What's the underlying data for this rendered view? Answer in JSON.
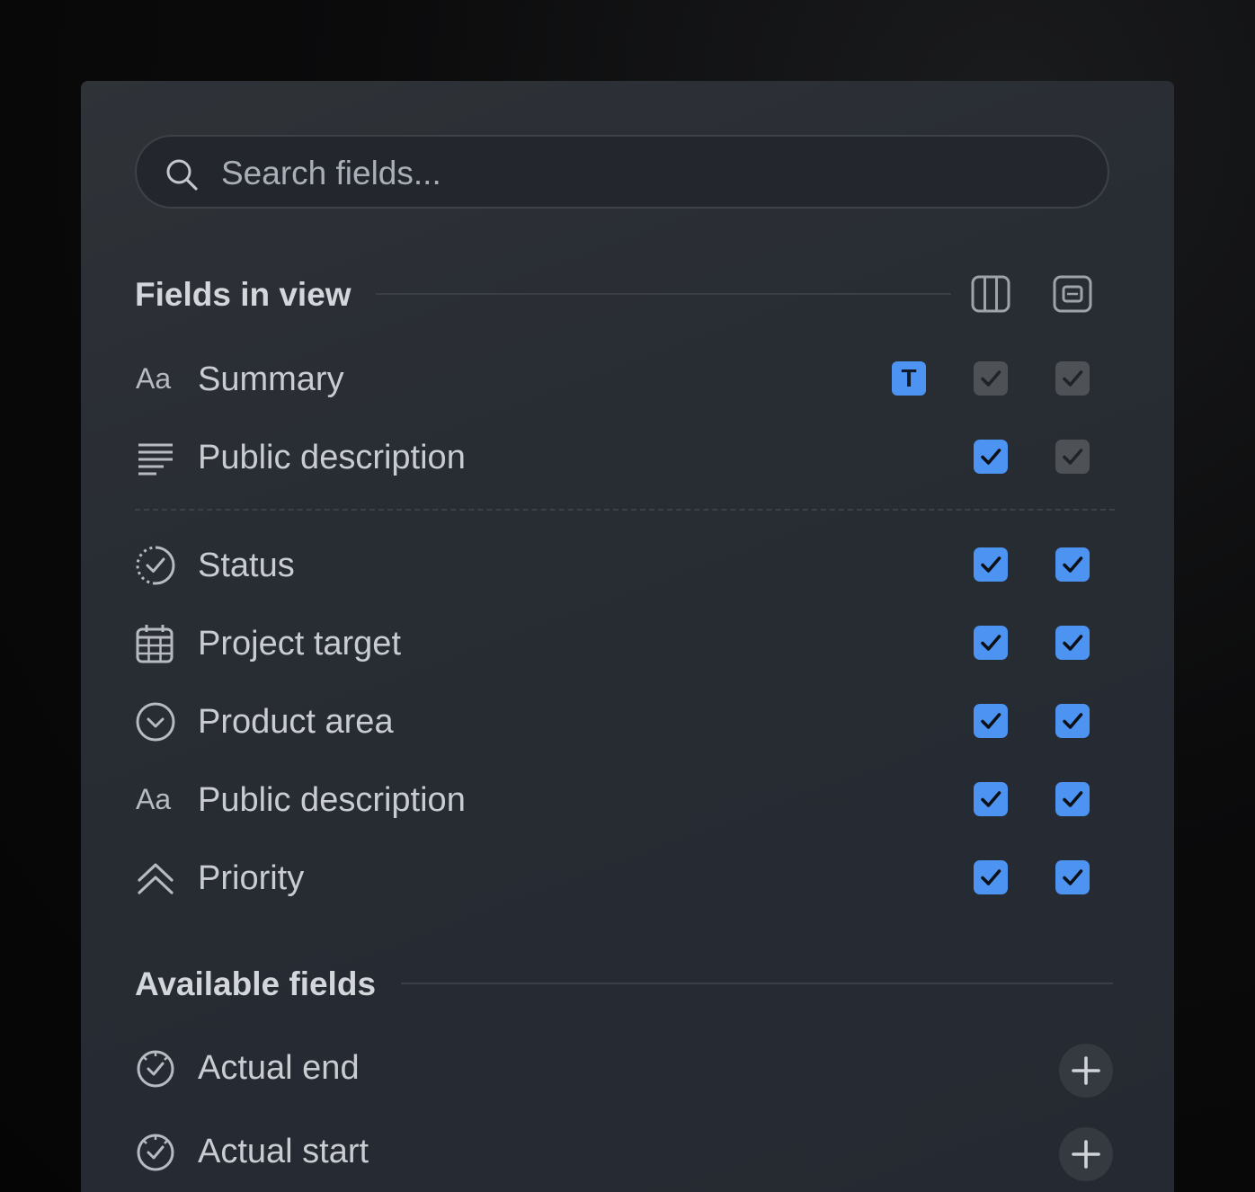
{
  "search": {
    "placeholder": "Search fields...",
    "value": ""
  },
  "fields_in_view": {
    "title": "Fields in view",
    "header_icons": [
      "columns-icon",
      "card-layout-icon"
    ],
    "pinned": [
      {
        "label": "Summary",
        "icon": "text-aa-icon",
        "badge": "T",
        "col1": "checked-disabled",
        "col2": "checked-disabled"
      },
      {
        "label": "Public description",
        "icon": "paragraph-lines-icon",
        "col1": "checked",
        "col2": "checked-disabled"
      }
    ],
    "items": [
      {
        "label": "Status",
        "icon": "status-dashed-check-icon",
        "col1": "checked",
        "col2": "checked"
      },
      {
        "label": "Project target",
        "icon": "calendar-icon",
        "col1": "checked",
        "col2": "checked"
      },
      {
        "label": "Product area",
        "icon": "circle-chevron-down-icon",
        "col1": "checked",
        "col2": "checked"
      },
      {
        "label": "Public description",
        "icon": "text-aa-icon",
        "col1": "checked",
        "col2": "checked"
      },
      {
        "label": "Priority",
        "icon": "double-chevron-up-icon",
        "col1": "checked",
        "col2": "checked"
      }
    ]
  },
  "available_fields": {
    "title": "Available fields",
    "items": [
      {
        "label": "Actual end",
        "icon": "clock-check-icon",
        "action_icon": "plus-icon"
      },
      {
        "label": "Actual start",
        "icon": "clock-check-icon",
        "action_icon": "plus-icon"
      }
    ]
  },
  "colors": {
    "accent": "#4c93f2",
    "panel": "#282c33",
    "disabled_check": "#4e5257"
  }
}
